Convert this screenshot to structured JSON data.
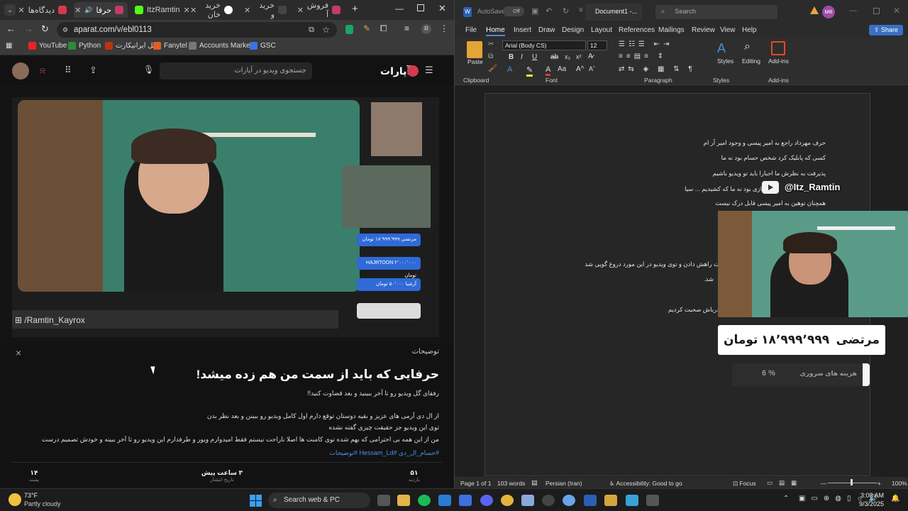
{
  "browser": {
    "tabs": [
      {
        "label": "دیدگاه‌ها",
        "color": "#d33b4c"
      },
      {
        "label": "حرفا",
        "color": "#c23b6b"
      },
      {
        "label": "ItzRamtin",
        "color": "#53fc18"
      },
      {
        "label": "خرید خان",
        "color": "#ffffff"
      },
      {
        "label": "خرید و",
        "color": "#444444"
      },
      {
        "label": "فروش آ",
        "color": "#c23b6b"
      }
    ],
    "url": "aparat.com/v/ebl0113",
    "bookmarks": [
      "YouTube",
      "Python",
      "پنل ایرانیکارت",
      "Fanytel",
      "Accounts Market",
      "GSC"
    ],
    "new_tab": "+"
  },
  "site": {
    "logo": "آپارات",
    "search_placeholder": "جستجوی ویدیو در آپارات"
  },
  "video": {
    "watermark": "/Ramtin_Kayrox",
    "donations": [
      {
        "name": "مرتضی",
        "amount": "۱۸٬۹۹۹٬۹۹۹ تومان"
      },
      {
        "name": "HAJRTOON",
        "amount": "۲٬۰۰۰٬۰۰۰ تومان"
      },
      {
        "name": "آرشیا",
        "amount": "۵۰٬۰۰۰ تومان"
      }
    ]
  },
  "description": {
    "section_label": "توضیحات",
    "close": "×",
    "title": "حرفایی که باید از سمت من هم زده میشد!",
    "subtitle": "رفقای گل ویدیو رو تا آخر ببینید و بعد قضاوت کنید!!",
    "body": [
      "از ال دی آرمی های عزیز و بقیه دوستان توقع دارم اول کامل ویدیو رو ببینن و بعد نظر بدن",
      "توی این ویدیو جز حقیقت چیزی گفته نشده",
      "من از این همه بی احترامی که بهم شده توی کامنت ها اصلا ناراحت نیستم فقط امیدوارم ویور و طرفدارم این ویدیو رو تا آخر ببینه و خودش تصمیم درست رو بگیره."
    ],
    "tags": "#حسام_ال_دی #Hessam_Ld #توضیحات",
    "stats": [
      {
        "value": "۵۱",
        "label": "بازدید"
      },
      {
        "value": "۳ ساعت پیش",
        "label": "تاریخ انتشار"
      },
      {
        "value": "۱۴",
        "label": "پسند"
      }
    ]
  },
  "word": {
    "autosave": "AutoSave",
    "autosave_state": "Off",
    "doc_name": "Document1 -...",
    "search": "Search",
    "user_initials": "MB",
    "share": "Share",
    "menus": [
      "File",
      "Home",
      "Insert",
      "Draw",
      "Design",
      "Layout",
      "References",
      "Mailings",
      "Review",
      "View",
      "Help"
    ],
    "font_name": "Arial (Body CS)",
    "font_size": "12",
    "groups": [
      "Clipboard",
      "Font",
      "Paragraph",
      "Styles",
      "Add-ins"
    ],
    "buttons": {
      "paste": "Paste",
      "styles": "Styles",
      "editing": "Editing",
      "addins": "Add-ins"
    },
    "doc_lines": [
      "حرف مهرداد راجع به امیر پیسی و وجود امیر آر ام",
      "کسی که پابلیک کرد شخص حسام بود نه ما",
      "پذیرفت به نظرش ما اجبارا باید تو ویدیو باشیم",
      "یک بازی بود نه ما که کشیدیم ... سیا",
      "همچنان توهین به امیر پیسی قابل درک نیست",
      "ت راهش دادن و توی ویدیو در این مورد دروغ گویی شد",
      "شد.",
      "درباش صحبت کردیم"
    ],
    "status": {
      "page": "Page 1 of 1",
      "words": "103 words",
      "language": "Persian (Iran)",
      "accessibility": "Accessibility: Good to go",
      "focus": "Focus",
      "zoom": "100%"
    }
  },
  "stream_overlay": {
    "handle": "@Itz_Ramtin",
    "donor": "مرتضی",
    "amount": "۱۸٬۹۹۹٬۹۹۹ تومان",
    "goal_label": "هزینه های ضروری",
    "goal_percent": "6 %"
  },
  "taskbar": {
    "temp": "73°F",
    "weather": "Partly cloudy",
    "search": "Search web & PC",
    "time": "3:08 AM",
    "date": "9/3/2025"
  }
}
